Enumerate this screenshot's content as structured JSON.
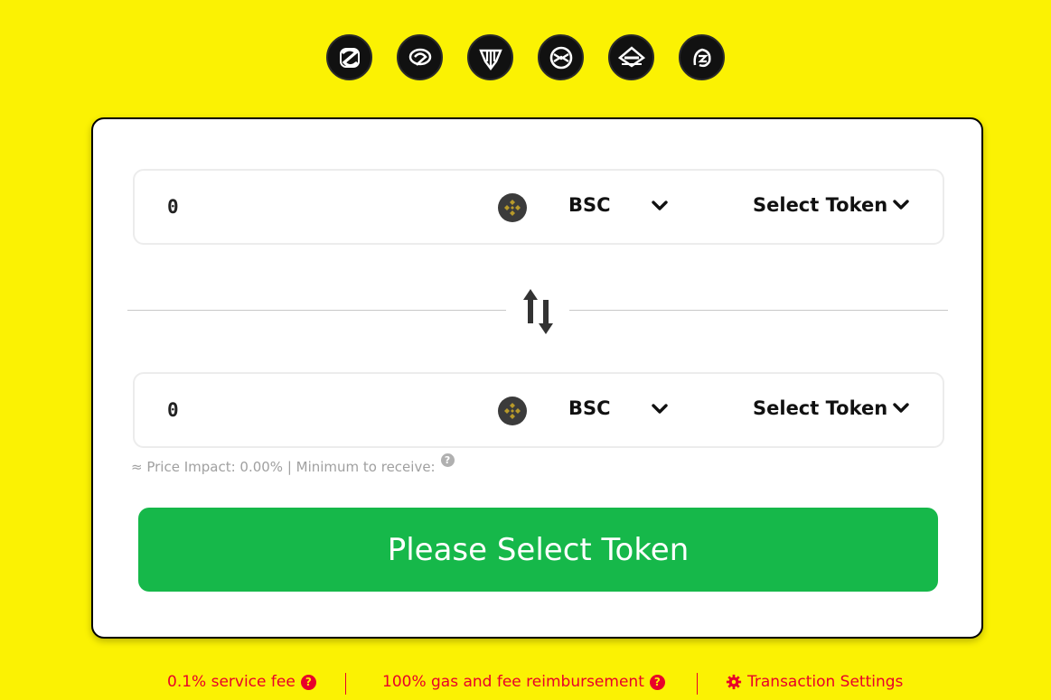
{
  "chains": [
    {
      "icon": "chain-logo-1-icon"
    },
    {
      "icon": "chain-logo-2-icon"
    },
    {
      "icon": "chain-logo-3-icon"
    },
    {
      "icon": "chain-logo-4-icon"
    },
    {
      "icon": "chain-logo-5-icon"
    },
    {
      "icon": "chain-logo-6-icon"
    }
  ],
  "from": {
    "amount": "0",
    "network": "BSC",
    "token_label": "Select Token"
  },
  "to": {
    "amount": "0",
    "network": "BSC",
    "token_label": "Select Token"
  },
  "info": {
    "text": "≈ Price Impact: 0.00% | Minimum to receive:",
    "help": "?"
  },
  "action_button": "Please Select Token",
  "footer": {
    "service_fee": "0.1% service fee",
    "reimbursement": "100% gas and fee reimbursement",
    "settings": "Transaction Settings",
    "help": "?"
  },
  "colors": {
    "background": "#fbf203",
    "primary_button": "#16b84a",
    "footer_text": "#e8002a"
  }
}
